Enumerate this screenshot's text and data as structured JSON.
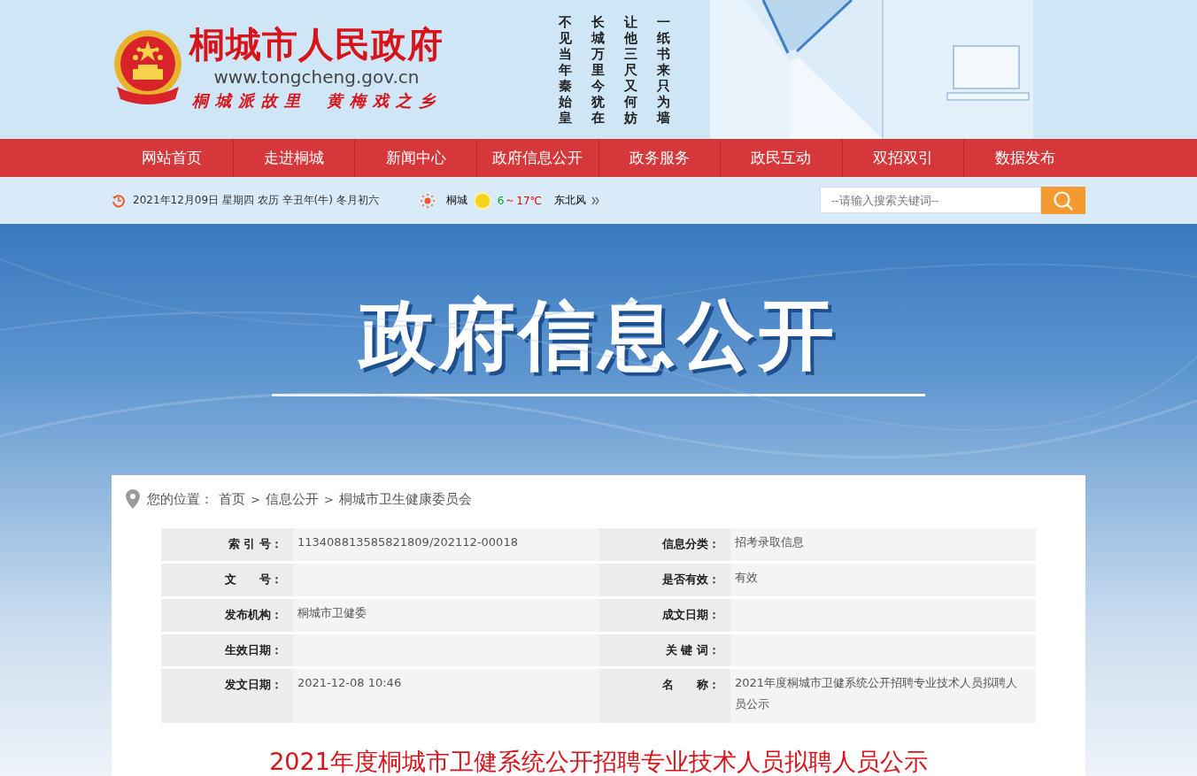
{
  "header": {
    "title": "桐城市人民政府",
    "url": "www.tongcheng.gov.cn",
    "slogans": [
      "桐城派故里",
      "黄梅戏之乡"
    ],
    "poem": [
      "不见当年秦始皇",
      "长城万里今犹在",
      "让他三尺又何妨",
      "一纸书来只为墙"
    ]
  },
  "nav": [
    {
      "label": "网站首页"
    },
    {
      "label": "走进桐城"
    },
    {
      "label": "新闻中心"
    },
    {
      "label": "政府信息公开"
    },
    {
      "label": "政务服务"
    },
    {
      "label": "政民互动"
    },
    {
      "label": "双招双引"
    },
    {
      "label": "数据发布"
    }
  ],
  "info_bar": {
    "date": "2021年12月09日 星期四 农历 辛丑年(牛) 冬月初六",
    "city": "桐城",
    "temp_low": "6",
    "temp_sep": "～",
    "temp_high": "17℃",
    "wind": "东北风"
  },
  "search": {
    "placeholder": "--请输入搜索关键词--"
  },
  "banner": {
    "title": "政府信息公开"
  },
  "breadcrumb": {
    "label": "您的位置：",
    "trail": [
      {
        "kind": "link",
        "text": "首页"
      },
      {
        "kind": "separator",
        "text": ">"
      },
      {
        "kind": "link",
        "text": "信息公开"
      },
      {
        "kind": "separator",
        "text": ">"
      },
      {
        "kind": "link",
        "text": "桐城市卫生健康委员会"
      }
    ]
  },
  "meta": [
    {
      "label_1": "索 引 号：",
      "value_1": "113408813585821809/202112-00018",
      "label_2": "信息分类：",
      "value_2": "招考录取信息"
    },
    {
      "label_1": "文　　号：",
      "label_2": "是否有效：",
      "value_2": "有效"
    },
    {
      "label_1": "发布机构：",
      "value_1": "桐城市卫健委",
      "label_2": "成文日期："
    },
    {
      "label_1": "生效日期：",
      "label_2": "关 键 词："
    },
    {
      "label_1": "发文日期：",
      "value_1": "2021-12-08 10:46",
      "label_2": "名　　称：",
      "value_2": "2021年度桐城市卫健系统公开招聘专业技术人员拟聘人员公示"
    }
  ],
  "article": {
    "title": "2021年度桐城市卫健系统公开招聘专业技术人员拟聘人员公示"
  }
}
